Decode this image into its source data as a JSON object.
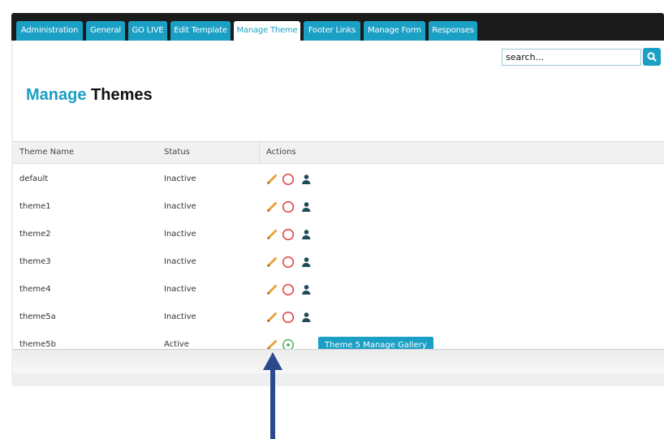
{
  "tabs": [
    {
      "label": "Administration"
    },
    {
      "label": "General"
    },
    {
      "label": "GO LIVE"
    },
    {
      "label": "Edit Template"
    },
    {
      "label": "Manage Theme",
      "active": true
    },
    {
      "label": "Footer Links"
    },
    {
      "label": "Manage Form"
    },
    {
      "label": "Responses"
    }
  ],
  "search": {
    "value": "search...",
    "icon": "search-icon"
  },
  "title": {
    "accent": "Manage",
    "rest": "Themes"
  },
  "table": {
    "headers": [
      "Theme Name",
      "Status",
      "Actions"
    ],
    "rows": [
      {
        "name": "default",
        "status": "Inactive",
        "actions": [
          "edit-icon",
          "deactivate-icon",
          "user-icon"
        ]
      },
      {
        "name": "theme1",
        "status": "Inactive",
        "actions": [
          "edit-icon",
          "deactivate-icon",
          "user-icon"
        ]
      },
      {
        "name": "theme2",
        "status": "Inactive",
        "actions": [
          "edit-icon",
          "deactivate-icon",
          "user-icon"
        ]
      },
      {
        "name": "theme3",
        "status": "Inactive",
        "actions": [
          "edit-icon",
          "deactivate-icon",
          "user-icon"
        ]
      },
      {
        "name": "theme4",
        "status": "Inactive",
        "actions": [
          "edit-icon",
          "deactivate-icon",
          "user-icon"
        ]
      },
      {
        "name": "theme5a",
        "status": "Inactive",
        "actions": [
          "edit-icon",
          "deactivate-icon",
          "user-icon"
        ]
      },
      {
        "name": "theme5b",
        "status": "Active",
        "actions": [
          "edit-icon",
          "active-icon"
        ],
        "button": "Theme 5 Manage Gallery"
      }
    ]
  },
  "colors": {
    "accent": "#1a9fc5",
    "tabbar": "#1b1b1b",
    "arrow": "#2b4a8e",
    "pencil": "#e8a33c",
    "deactivate": "#e03c3c",
    "active": "#3aa84a",
    "user": "#1f4a57"
  }
}
